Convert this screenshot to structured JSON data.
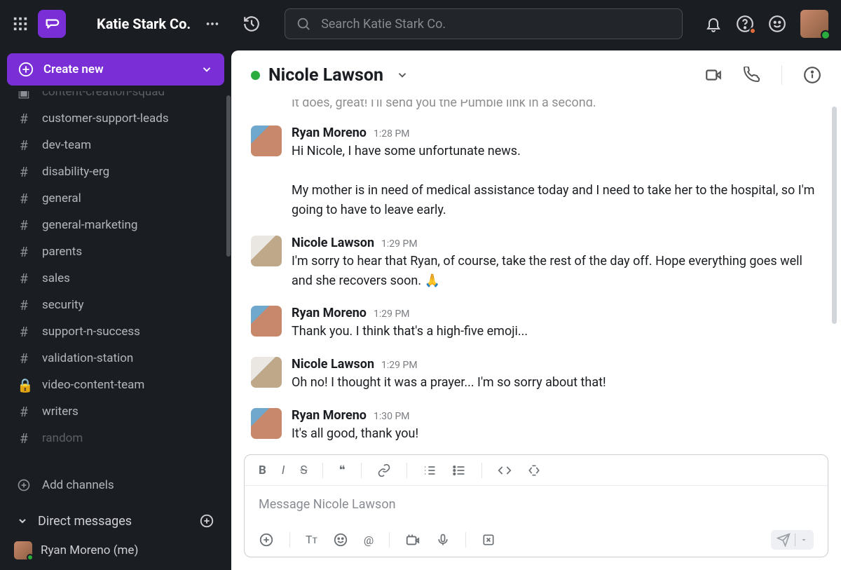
{
  "workspace": {
    "name": "Katie Stark Co."
  },
  "search": {
    "placeholder": "Search Katie Stark Co."
  },
  "create": {
    "label": "Create new"
  },
  "channels": [
    {
      "prefix": "▣",
      "name": "content-creation-squad",
      "faded": true
    },
    {
      "prefix": "#",
      "name": "customer-support-leads"
    },
    {
      "prefix": "#",
      "name": "dev-team"
    },
    {
      "prefix": "#",
      "name": "disability-erg"
    },
    {
      "prefix": "#",
      "name": "general"
    },
    {
      "prefix": "#",
      "name": "general-marketing"
    },
    {
      "prefix": "#",
      "name": "parents"
    },
    {
      "prefix": "#",
      "name": "sales"
    },
    {
      "prefix": "#",
      "name": "security"
    },
    {
      "prefix": "#",
      "name": "support-n-success"
    },
    {
      "prefix": "#",
      "name": "validation-station"
    },
    {
      "prefix": "🔒",
      "name": "video-content-team"
    },
    {
      "prefix": "#",
      "name": "writers"
    },
    {
      "prefix": "#",
      "name": "random",
      "faded": true
    }
  ],
  "addChannels": {
    "label": "Add channels"
  },
  "dm": {
    "header": "Direct messages",
    "self": "Ryan Moreno (me)"
  },
  "chat": {
    "title": "Nicole Lawson",
    "cutoff": "It does, great! I'll send you the Pumble link in a second."
  },
  "messages": [
    {
      "author": "Ryan Moreno",
      "time": "1:28 PM",
      "avatar": "ryan",
      "text": "Hi Nicole, I have some unfortunate news."
    },
    {
      "continuation": true,
      "text": "My mother is in need of medical assistance today and I need to take her to the hospital, so I'm going to have to leave early."
    },
    {
      "author": "Nicole Lawson",
      "time": "1:29 PM",
      "avatar": "nicole",
      "text": "I'm sorry to hear that Ryan, of course, take the rest of the day off. Hope everything goes well and she recovers soon. 🙏"
    },
    {
      "author": "Ryan Moreno",
      "time": "1:29 PM",
      "avatar": "ryan",
      "text": "Thank you. I think that's a high-five emoji..."
    },
    {
      "author": "Nicole Lawson",
      "time": "1:29 PM",
      "avatar": "nicole",
      "text": "Oh no! I thought it was a prayer... I'm so sorry about that!"
    },
    {
      "author": "Ryan Moreno",
      "time": "1:30 PM",
      "avatar": "ryan",
      "text": "It's all good, thank you!"
    }
  ],
  "composer": {
    "placeholder": "Message Nicole Lawson"
  }
}
